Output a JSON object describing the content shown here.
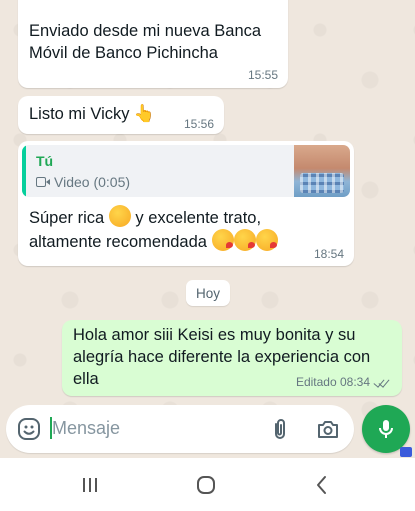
{
  "messages": {
    "m1": {
      "text": "Enviado desde mi nueva Banca Móvil de Banco Pichincha",
      "time": "15:55"
    },
    "m2": {
      "text": "Listo mi Vicky",
      "emoji": "👆",
      "time": "15:56"
    },
    "m3": {
      "quote_author": "Tú",
      "quote_text": "Video (0:05)",
      "text_line1": "Súper rica",
      "text_line1_cont": "y excelente trato,",
      "text_line2": "altamente recomendada",
      "time": "18:54"
    },
    "date_chip": "Hoy",
    "m4": {
      "text": "Hola amor siii Keisi es muy bonita y su alegría hace diferente la experiencia con ella",
      "edited_label": "Editado 08:34"
    }
  },
  "input": {
    "placeholder": "Mensaje"
  },
  "colors": {
    "chat_bg": "#efe7de",
    "incoming_bubble": "#ffffff",
    "outgoing_bubble": "#d9fdd3",
    "accent_green": "#1fa855",
    "quote_bar": "#06cf9c"
  },
  "icons": [
    "emoji-icon",
    "attach-icon",
    "camera-icon",
    "mic-icon",
    "video-icon",
    "recents-icon",
    "home-icon",
    "back-icon",
    "double-check-icon"
  ]
}
